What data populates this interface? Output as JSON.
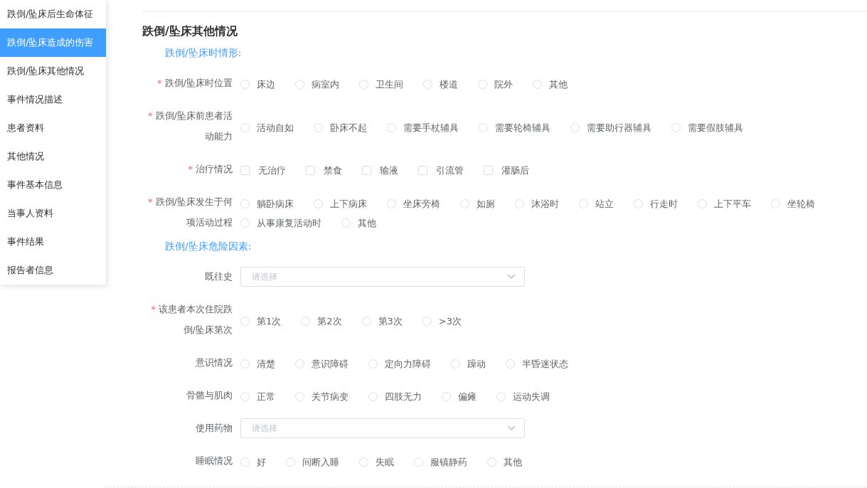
{
  "sidebar": {
    "items": [
      {
        "label": "跌倒/坠床后生命体征",
        "selected": false
      },
      {
        "label": "跌倒/坠床造成的伤害",
        "selected": true
      },
      {
        "label": "跌倒/坠床其他情况",
        "selected": false
      },
      {
        "label": "事件情况描述",
        "selected": false
      },
      {
        "label": "患者资料",
        "selected": false
      },
      {
        "label": "其他情况",
        "selected": false
      },
      {
        "label": "事件基本信息",
        "selected": false
      },
      {
        "label": "当事人资料",
        "selected": false
      },
      {
        "label": "事件结果",
        "selected": false
      },
      {
        "label": "报告者信息",
        "selected": false
      }
    ]
  },
  "title": "跌倒/坠床其他情况",
  "sections": [
    {
      "heading": "跌倒/坠床时情形:",
      "fields": [
        {
          "label": "跌倒/坠床时位置",
          "required_mark": "*",
          "kind": "radio",
          "options": [
            {
              "label": "床边",
              "selected": false
            },
            {
              "label": "病室内",
              "selected": false
            },
            {
              "label": "卫生间",
              "selected": false
            },
            {
              "label": "楼道",
              "selected": false
            },
            {
              "label": "院外",
              "selected": false
            },
            {
              "label": "其他",
              "selected": false
            }
          ]
        },
        {
          "label": "跌倒/坠床前患者活动能力",
          "required_mark": "*",
          "kind": "radio",
          "options": [
            {
              "label": "活动自如",
              "selected": false
            },
            {
              "label": "卧床不起",
              "selected": false
            },
            {
              "label": "需要手杖辅具",
              "selected": false
            },
            {
              "label": "需要轮椅辅具",
              "selected": false
            },
            {
              "label": "需要助行器辅具",
              "selected": false
            },
            {
              "label": "需要假肢辅具",
              "selected": false
            }
          ]
        },
        {
          "label": "治疗情况",
          "required_mark": "*",
          "kind": "checkbox",
          "options": [
            {
              "label": "无治疗",
              "checked": false
            },
            {
              "label": "禁食",
              "checked": false
            },
            {
              "label": "输液",
              "checked": false
            },
            {
              "label": "引流管",
              "checked": false
            },
            {
              "label": "灌肠后",
              "checked": false
            }
          ]
        },
        {
          "label": "跌倒/坠床发生于何项活动过程",
          "required_mark": "*",
          "kind": "radio",
          "options": [
            {
              "label": "躺卧病床",
              "selected": false
            },
            {
              "label": "上下病床",
              "selected": false
            },
            {
              "label": "坐床旁椅",
              "selected": false
            },
            {
              "label": "如厕",
              "selected": false
            },
            {
              "label": "沐浴时",
              "selected": false
            },
            {
              "label": "站立",
              "selected": false
            },
            {
              "label": "行走时",
              "selected": false
            },
            {
              "label": "上下平车",
              "selected": false
            },
            {
              "label": "坐轮椅",
              "selected": false
            },
            {
              "label": "从事康复活动时",
              "selected": false
            },
            {
              "label": "其他",
              "selected": false
            }
          ]
        }
      ]
    },
    {
      "heading": "跌倒/坠床危险因素:",
      "fields": [
        {
          "label": "既往史",
          "kind": "select",
          "placeholder": "请选择"
        },
        {
          "label": "该患者本次住院跌倒/坠床第次",
          "required_mark": "*",
          "kind": "radio",
          "options": [
            {
              "label": "第1次",
              "selected": false
            },
            {
              "label": "第2次",
              "selected": false
            },
            {
              "label": "第3次",
              "selected": false
            },
            {
              "label": ">3次",
              "selected": false
            }
          ]
        },
        {
          "label": "意识情况",
          "kind": "radio",
          "options": [
            {
              "label": "清楚",
              "selected": false
            },
            {
              "label": "意识障碍",
              "selected": false
            },
            {
              "label": "定向力障碍",
              "selected": false
            },
            {
              "label": "躁动",
              "selected": false
            },
            {
              "label": "半昏迷状态",
              "selected": false
            }
          ]
        },
        {
          "label": "骨骼与肌肉",
          "kind": "radio",
          "options": [
            {
              "label": "正常",
              "selected": false
            },
            {
              "label": "关节病变",
              "selected": false
            },
            {
              "label": "四肢无力",
              "selected": false
            },
            {
              "label": "偏瘫",
              "selected": false
            },
            {
              "label": "运动失调",
              "selected": false
            }
          ]
        },
        {
          "label": "使用药物",
          "kind": "select",
          "placeholder": "请选择"
        },
        {
          "label": "睡眠情况",
          "kind": "radio",
          "options": [
            {
              "label": "好",
              "selected": false
            },
            {
              "label": "间断入睡",
              "selected": false
            },
            {
              "label": "失眠",
              "selected": false
            },
            {
              "label": "服镇静药",
              "selected": false
            },
            {
              "label": "其他",
              "selected": false
            }
          ]
        }
      ]
    }
  ]
}
